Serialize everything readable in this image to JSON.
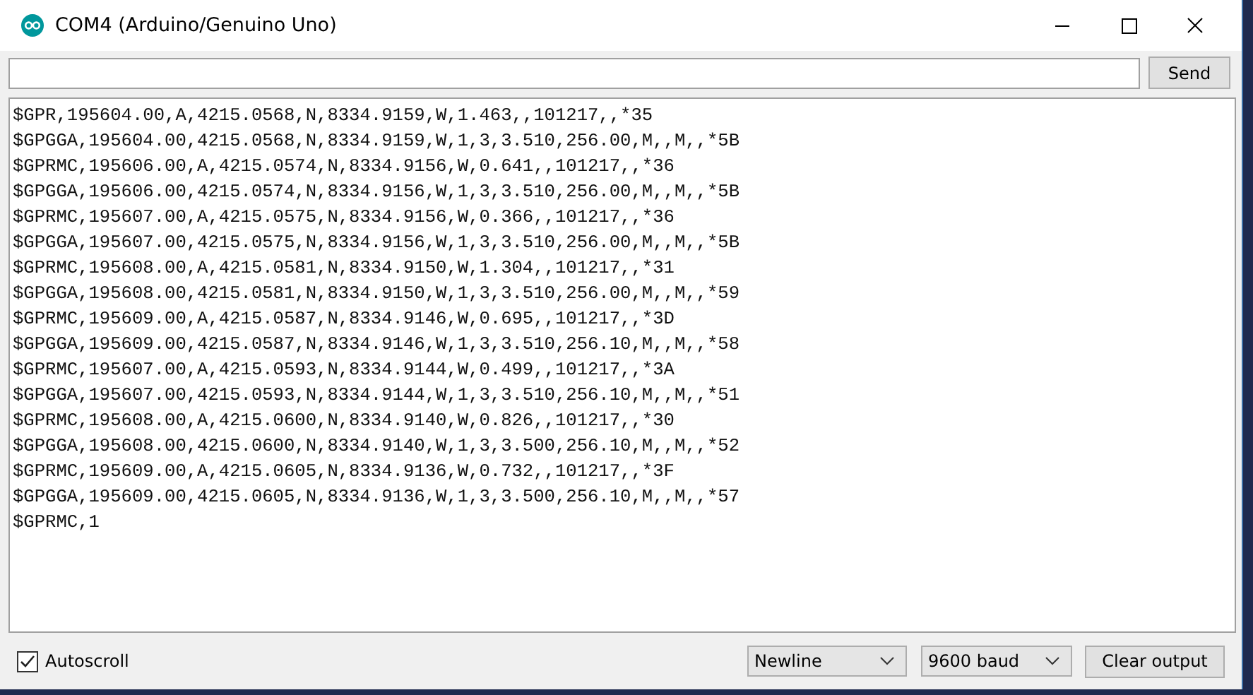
{
  "window": {
    "title": "COM4 (Arduino/Genuino Uno)"
  },
  "send_button": "Send",
  "output_lines": [
    "$GPR,195604.00,A,4215.0568,N,8334.9159,W,1.463,,101217,,*35",
    "$GPGGA,195604.00,4215.0568,N,8334.9159,W,1,3,3.510,256.00,M,,M,,*5B",
    "$GPRMC,195606.00,A,4215.0574,N,8334.9156,W,0.641,,101217,,*36",
    "$GPGGA,195606.00,4215.0574,N,8334.9156,W,1,3,3.510,256.00,M,,M,,*5B",
    "$GPRMC,195607.00,A,4215.0575,N,8334.9156,W,0.366,,101217,,*36",
    "$GPGGA,195607.00,4215.0575,N,8334.9156,W,1,3,3.510,256.00,M,,M,,*5B",
    "$GPRMC,195608.00,A,4215.0581,N,8334.9150,W,1.304,,101217,,*31",
    "$GPGGA,195608.00,4215.0581,N,8334.9150,W,1,3,3.510,256.00,M,,M,,*59",
    "$GPRMC,195609.00,A,4215.0587,N,8334.9146,W,0.695,,101217,,*3D",
    "$GPGGA,195609.00,4215.0587,N,8334.9146,W,1,3,3.510,256.10,M,,M,,*58",
    "$GPRMC,195607.00,A,4215.0593,N,8334.9144,W,0.499,,101217,,*3A",
    "$GPGGA,195607.00,4215.0593,N,8334.9144,W,1,3,3.510,256.10,M,,M,,*51",
    "$GPRMC,195608.00,A,4215.0600,N,8334.9140,W,0.826,,101217,,*30",
    "$GPGGA,195608.00,4215.0600,N,8334.9140,W,1,3,3.500,256.10,M,,M,,*52",
    "$GPRMC,195609.00,A,4215.0605,N,8334.9136,W,0.732,,101217,,*3F",
    "$GPGGA,195609.00,4215.0605,N,8334.9136,W,1,3,3.500,256.10,M,,M,,*57",
    "$GPRMC,1"
  ],
  "autoscroll": {
    "label": "Autoscroll",
    "checked": true
  },
  "line_ending": "Newline",
  "baud_rate": "9600 baud",
  "clear_button": "Clear output"
}
